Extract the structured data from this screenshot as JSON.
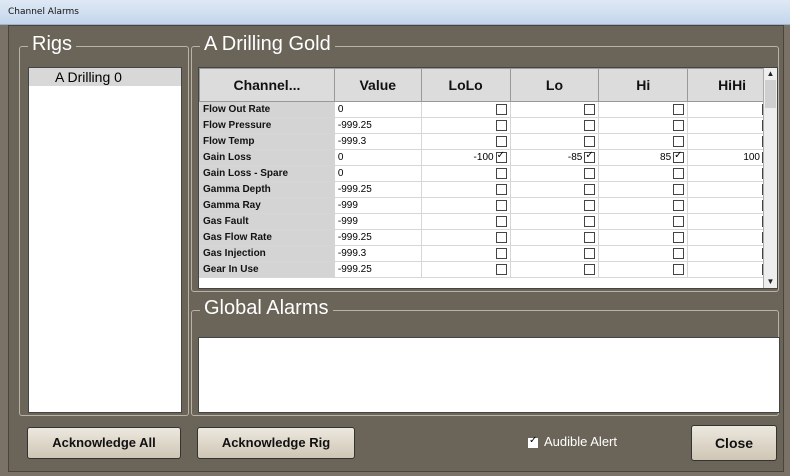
{
  "window": {
    "title": "Channel Alarms"
  },
  "rigs": {
    "title": "Rigs",
    "items": [
      {
        "label": "A Drilling 0"
      }
    ]
  },
  "grid_panel": {
    "title": "A Drilling Gold",
    "headers": [
      "Channel...",
      "Value",
      "LoLo",
      "Lo",
      "Hi",
      "HiHi"
    ],
    "rows": [
      {
        "channel": "Flow Out Rate",
        "value": "0",
        "lolo": "",
        "lo": "",
        "hi": "",
        "hihi": ""
      },
      {
        "channel": "Flow Pressure",
        "value": "-999.25",
        "lolo": "",
        "lo": "",
        "hi": "",
        "hihi": ""
      },
      {
        "channel": "Flow Temp",
        "value": "-999.3",
        "lolo": "",
        "lo": "",
        "hi": "",
        "hihi": ""
      },
      {
        "channel": "Gain Loss",
        "value": "0",
        "lolo": "-100",
        "lo": "-85",
        "hi": "85",
        "hihi": "100"
      },
      {
        "channel": "Gain Loss - Spare",
        "value": "0",
        "lolo": "",
        "lo": "",
        "hi": "",
        "hihi": ""
      },
      {
        "channel": "Gamma Depth",
        "value": "-999.25",
        "lolo": "",
        "lo": "",
        "hi": "",
        "hihi": ""
      },
      {
        "channel": "Gamma Ray",
        "value": "-999",
        "lolo": "",
        "lo": "",
        "hi": "",
        "hihi": ""
      },
      {
        "channel": "Gas Fault",
        "value": "-999",
        "lolo": "",
        "lo": "",
        "hi": "",
        "hihi": ""
      },
      {
        "channel": "Gas Flow Rate",
        "value": "-999.25",
        "lolo": "",
        "lo": "",
        "hi": "",
        "hihi": ""
      },
      {
        "channel": "Gas Injection",
        "value": "-999.3",
        "lolo": "",
        "lo": "",
        "hi": "",
        "hihi": ""
      },
      {
        "channel": "Gear In Use",
        "value": "-999.25",
        "lolo": "",
        "lo": "",
        "hi": "",
        "hihi": ""
      }
    ]
  },
  "global_alarms": {
    "title": "Global Alarms"
  },
  "buttons": {
    "acknowledge_all": "Acknowledge All",
    "acknowledge_rig": "Acknowledge Rig",
    "close": "Close"
  },
  "audible_alert": {
    "label": "Audible Alert",
    "checked": true
  }
}
